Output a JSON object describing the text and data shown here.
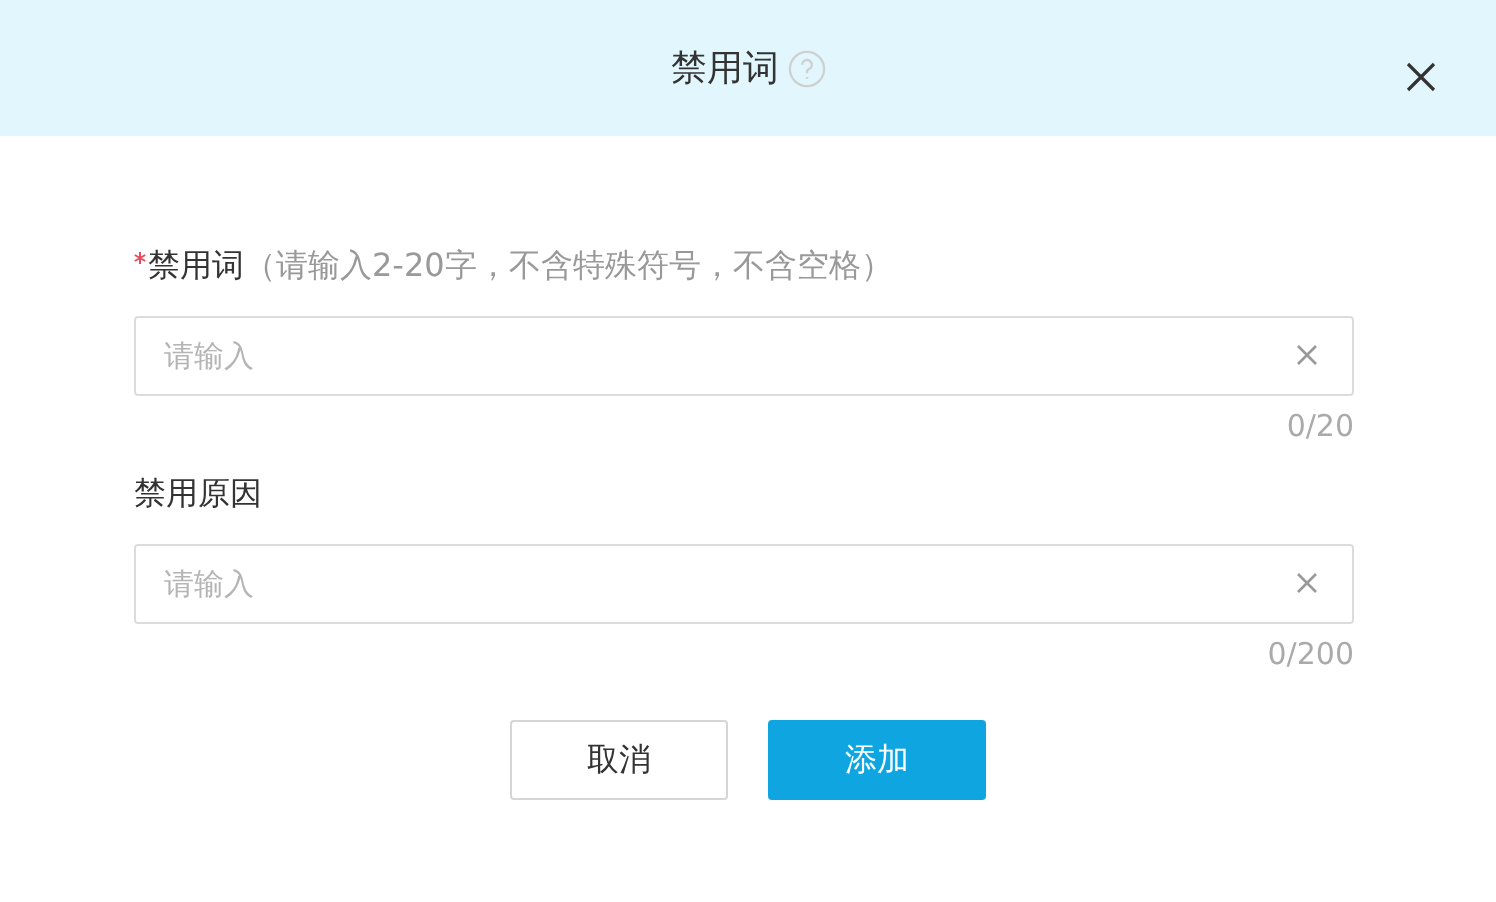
{
  "dialog": {
    "title": "禁用词"
  },
  "fields": [
    {
      "label": "禁用词",
      "required": true,
      "hint": "（请输入2-20字，不含特殊符号，不含空格）",
      "placeholder": "请输入",
      "counter": "0/20"
    },
    {
      "label": "禁用原因",
      "required": false,
      "placeholder": "请输入",
      "counter": "0/200"
    }
  ],
  "buttons": [
    {
      "label": "取消",
      "kind": "secondary"
    },
    {
      "label": "添加",
      "kind": "primary"
    }
  ]
}
